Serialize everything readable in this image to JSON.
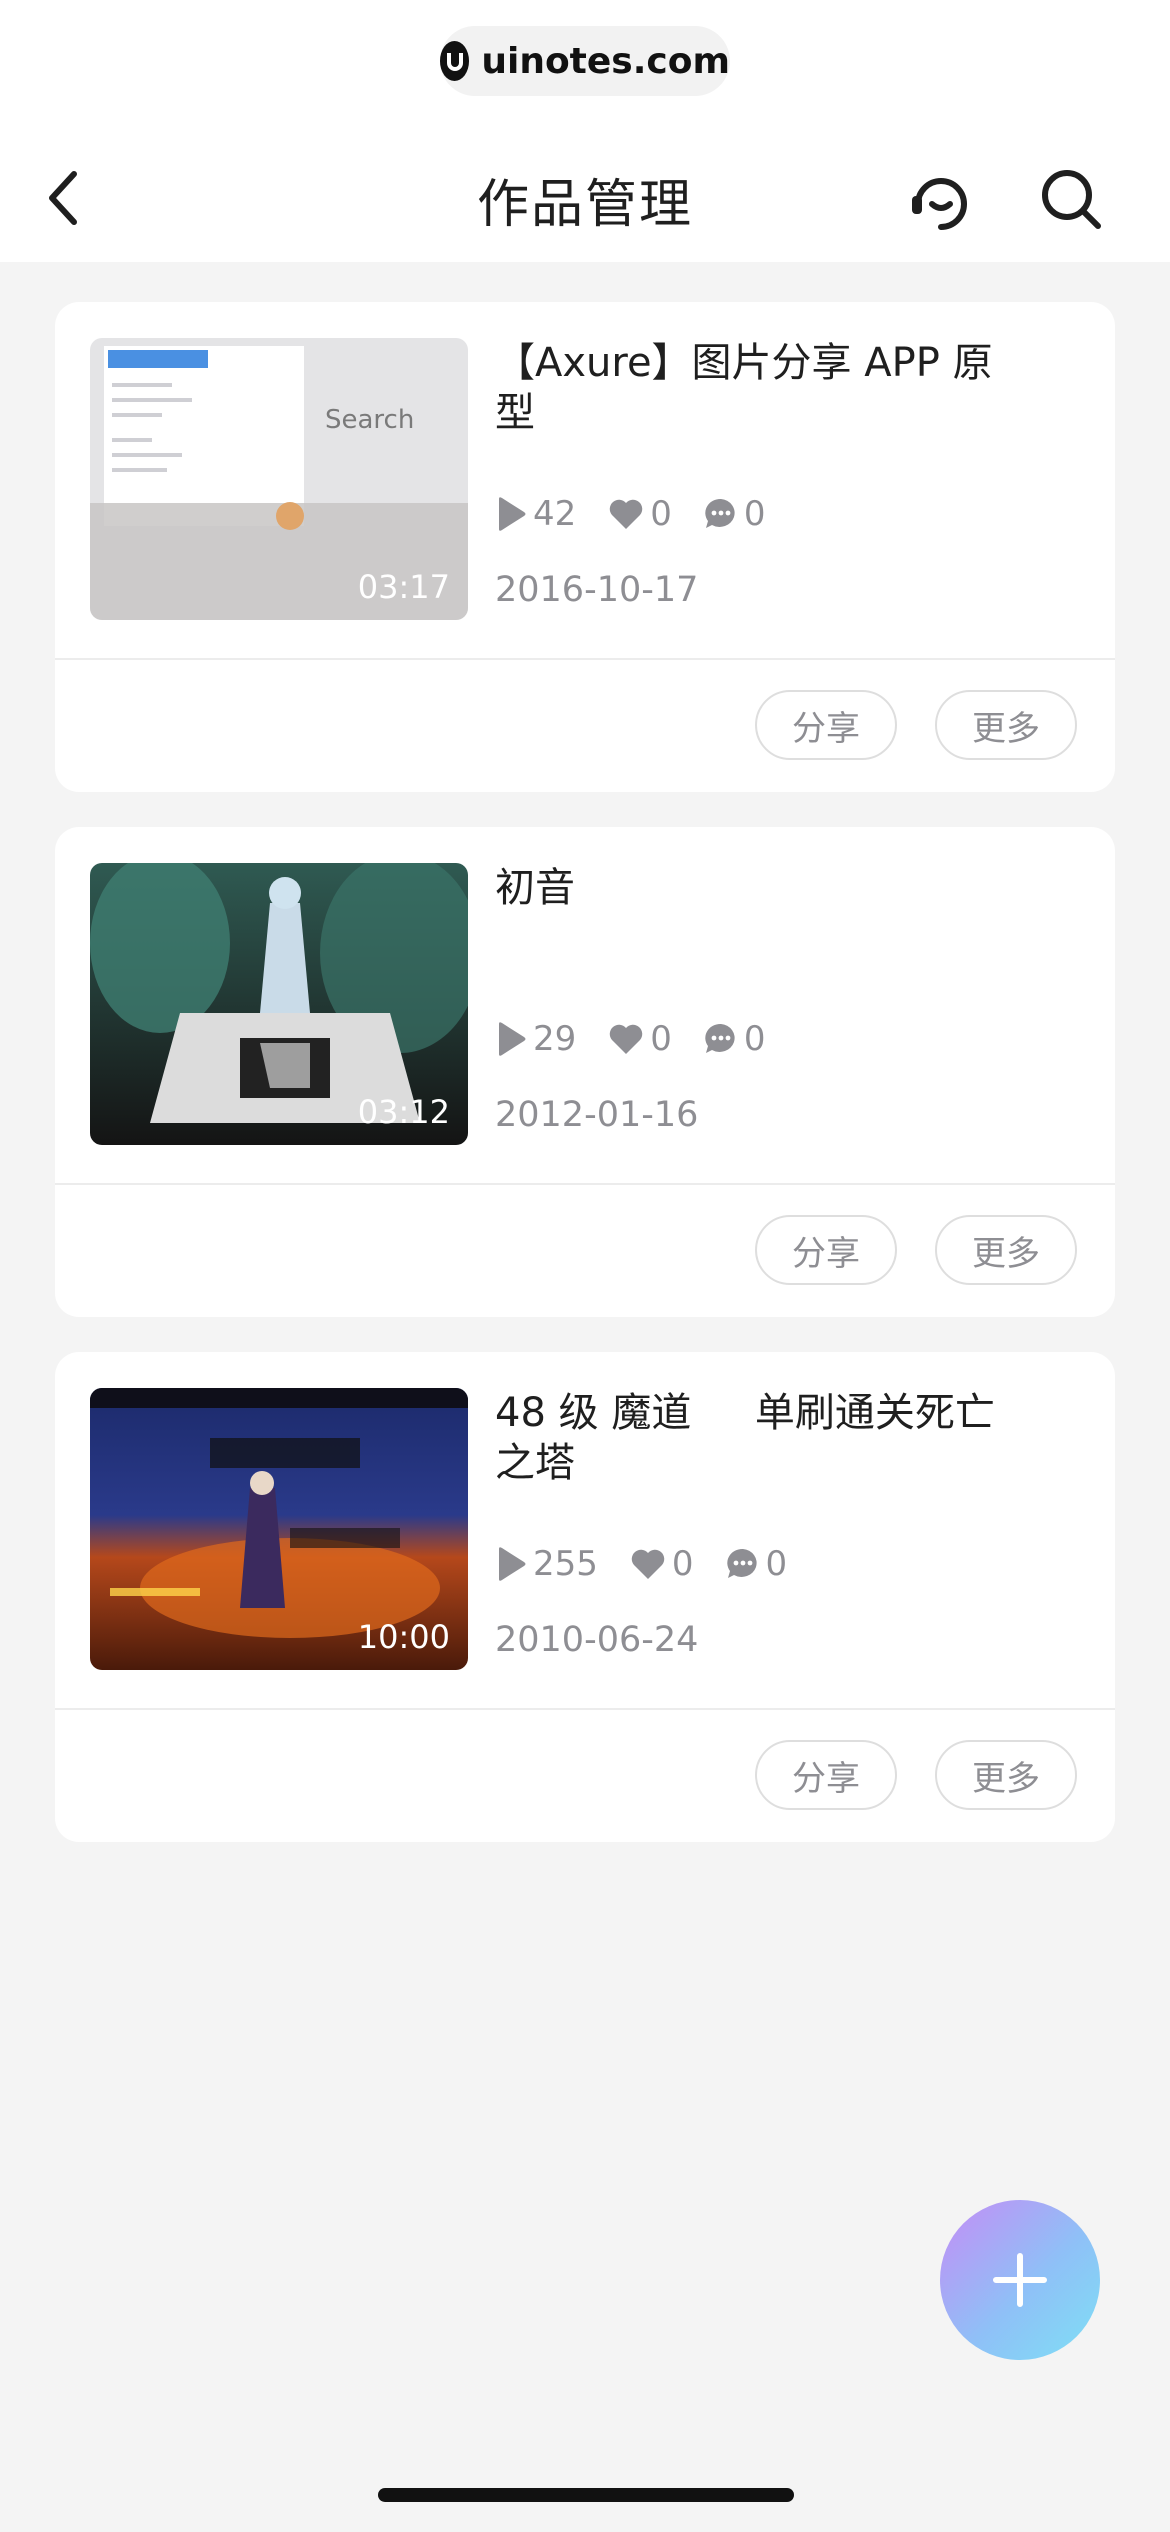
{
  "browser": {
    "url": "uinotes.com"
  },
  "header": {
    "title": "作品管理"
  },
  "icons": {
    "back": "chevron-left-icon",
    "support": "headset-icon",
    "search": "search-icon",
    "play": "play-icon",
    "like": "heart-icon",
    "comment": "comment-icon",
    "add": "plus-icon"
  },
  "actions": {
    "share_label": "分享",
    "more_label": "更多"
  },
  "works": [
    {
      "title": "【Axure】图片分享 APP 原型",
      "duration": "03:17",
      "plays": "42",
      "likes": "0",
      "comments": "0",
      "date": "2016-10-17",
      "thumb_text": "Search"
    },
    {
      "title": "初音",
      "duration": "03:12",
      "plays": "29",
      "likes": "0",
      "comments": "0",
      "date": "2012-01-16"
    },
    {
      "title": "48 级 魔道     单刷通关死亡之塔",
      "duration": "10:00",
      "plays": "255",
      "likes": "0",
      "comments": "0",
      "date": "2010-06-24"
    }
  ],
  "colors": {
    "fab_gradient_start": "#c58cf5",
    "fab_gradient_end": "#7ee0f5",
    "muted_text": "#8e8e93"
  }
}
